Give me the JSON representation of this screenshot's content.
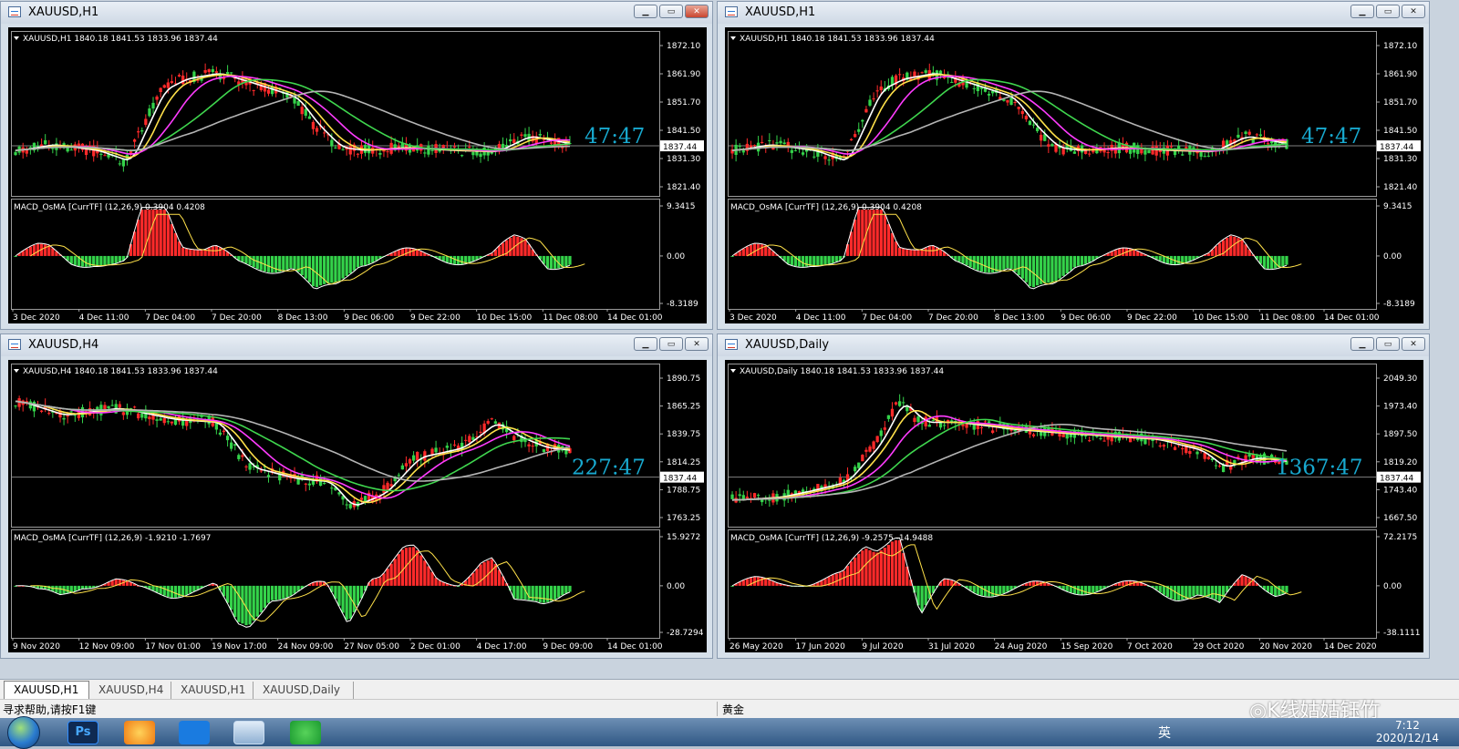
{
  "colors": {
    "bull": "#ff2a2a",
    "bear": "#34d34a",
    "ma_fast": "#ffffff",
    "ma_2": "#ffe14a",
    "ma_3": "#ff3cff",
    "ma_4": "#3fd64e",
    "ma_5": "#b4b4b4",
    "timer": "#18a9cf",
    "grid": "#888888"
  },
  "windows": [
    {
      "id": "w1",
      "title": "XAUUSD,H1",
      "info": "XAUUSD,H1  1840.18 1841.53 1833.96 1837.44",
      "timer": "47:47",
      "price_ticks": [
        "1872.10",
        "1861.90",
        "1851.70",
        "1841.50",
        "1831.30",
        "1821.40"
      ],
      "current": "1837.44",
      "macd_label": "MACD_OsMA [CurrTF] (12,26,9) 0.3904 0.4208",
      "macd_ticks": [
        "9.3415",
        "0.00",
        "-8.3189"
      ],
      "x_labels": [
        "3 Dec 2020",
        "4 Dec 11:00",
        "7 Dec 04:00",
        "7 Dec 20:00",
        "8 Dec 13:00",
        "9 Dec 06:00",
        "9 Dec 22:00",
        "10 Dec 15:00",
        "11 Dec 08:00",
        "14 Dec 01:00"
      ],
      "buttons": {
        "min": "▁",
        "max": "▭",
        "close": "✕"
      }
    },
    {
      "id": "w2",
      "title": "XAUUSD,H1",
      "info": "XAUUSD,H1  1840.18 1841.53 1833.96 1837.44",
      "timer": "47:47",
      "price_ticks": [
        "1872.10",
        "1861.90",
        "1851.70",
        "1841.50",
        "1831.30",
        "1821.40"
      ],
      "current": "1837.44",
      "macd_label": "MACD_OsMA [CurrTF] (12,26,9) 0.3904 0.4208",
      "macd_ticks": [
        "9.3415",
        "0.00",
        "-8.3189"
      ],
      "x_labels": [
        "3 Dec 2020",
        "4 Dec 11:00",
        "7 Dec 04:00",
        "7 Dec 20:00",
        "8 Dec 13:00",
        "9 Dec 06:00",
        "9 Dec 22:00",
        "10 Dec 15:00",
        "11 Dec 08:00",
        "14 Dec 01:00"
      ],
      "buttons": {
        "min": "▁",
        "max": "▭",
        "close": "✕"
      }
    },
    {
      "id": "w3",
      "title": "XAUUSD,H4",
      "info": "XAUUSD,H4  1840.18 1841.53 1833.96 1837.44",
      "timer": "227:47",
      "price_ticks": [
        "1890.75",
        "1865.25",
        "1839.75",
        "1814.25",
        "1788.75",
        "1763.25"
      ],
      "current": "1837.44",
      "macd_label": "MACD_OsMA [CurrTF] (12,26,9) -1.9210 -1.7697",
      "macd_ticks": [
        "15.9272",
        "0.00",
        "-28.7294"
      ],
      "x_labels": [
        "9 Nov 2020",
        "12 Nov 09:00",
        "17 Nov 01:00",
        "19 Nov 17:00",
        "24 Nov 09:00",
        "27 Nov 05:00",
        "2 Dec 01:00",
        "4 Dec 17:00",
        "9 Dec 09:00",
        "14 Dec 01:00"
      ],
      "buttons": {
        "min": "▁",
        "max": "▭",
        "close": "✕"
      }
    },
    {
      "id": "w4",
      "title": "XAUUSD,Daily",
      "info": "XAUUSD,Daily  1840.18 1841.53 1833.96 1837.44",
      "timer": "1367:47",
      "price_ticks": [
        "2049.30",
        "1973.40",
        "1897.50",
        "1819.20",
        "1743.40",
        "1667.50"
      ],
      "current": "1837.44",
      "macd_label": "MACD_OsMA [CurrTF] (12,26,9) -9.2575 -14.9488",
      "macd_ticks": [
        "72.2175",
        "0.00",
        "-38.1111"
      ],
      "x_labels": [
        "26 May 2020",
        "17 Jun 2020",
        "9 Jul 2020",
        "31 Jul 2020",
        "24 Aug 2020",
        "15 Sep 2020",
        "7 Oct 2020",
        "29 Oct 2020",
        "20 Nov 2020",
        "14 Dec 2020"
      ],
      "buttons": {
        "min": "▁",
        "max": "▭",
        "close": "✕"
      }
    }
  ],
  "tabs": [
    {
      "label": "XAUUSD,H1",
      "active": true
    },
    {
      "label": "XAUUSD,H4"
    },
    {
      "label": "XAUUSD,H1"
    },
    {
      "label": "XAUUSD,Daily"
    }
  ],
  "status": {
    "help": "寻求帮助,请按F1键",
    "symbol": "黄金",
    "watermark": "◎K线姑姑钰竹"
  },
  "taskbar": {
    "apps": [
      "photoshop-icon",
      "browser-icon",
      "app-icon",
      "terminal-icon",
      "wechat-icon"
    ],
    "ime": "英",
    "time": "7:12",
    "date": "2020/12/14"
  }
}
